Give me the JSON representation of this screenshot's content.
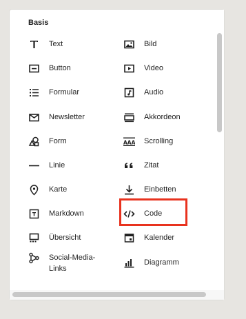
{
  "section": {
    "title": "Basis"
  },
  "items": [
    {
      "label": "Text",
      "icon": "text-icon"
    },
    {
      "label": "Bild",
      "icon": "image-icon"
    },
    {
      "label": "Button",
      "icon": "button-icon"
    },
    {
      "label": "Video",
      "icon": "video-icon"
    },
    {
      "label": "Formular",
      "icon": "form-list-icon"
    },
    {
      "label": "Audio",
      "icon": "audio-icon"
    },
    {
      "label": "Newsletter",
      "icon": "envelope-icon"
    },
    {
      "label": "Akkordeon",
      "icon": "accordion-icon"
    },
    {
      "label": "Form",
      "icon": "shapes-icon"
    },
    {
      "label": "Scrolling",
      "icon": "scrolling-icon"
    },
    {
      "label": "Linie",
      "icon": "line-icon"
    },
    {
      "label": "Zitat",
      "icon": "quote-icon"
    },
    {
      "label": "Karte",
      "icon": "map-pin-icon"
    },
    {
      "label": "Einbetten",
      "icon": "embed-icon"
    },
    {
      "label": "Markdown",
      "icon": "markdown-icon"
    },
    {
      "label": "Code",
      "icon": "code-icon"
    },
    {
      "label": "Übersicht",
      "icon": "summary-icon"
    },
    {
      "label": "Kalender",
      "icon": "calendar-icon"
    },
    {
      "label": "Social-Media-Links",
      "icon": "share-icon"
    },
    {
      "label": "Diagramm",
      "icon": "chart-icon"
    }
  ],
  "colors": {
    "highlight": "#e8321e",
    "background": "#e7e5e1",
    "panel": "#ffffff"
  }
}
